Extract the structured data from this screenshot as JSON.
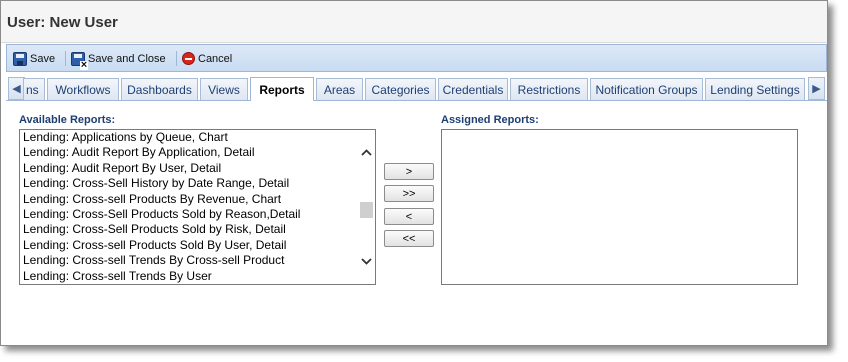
{
  "window": {
    "title": "User: New User"
  },
  "toolbar": {
    "save_label": "Save",
    "save_close_label": "Save and Close",
    "cancel_label": "Cancel"
  },
  "tabs": {
    "partial_label": "ns",
    "items": [
      {
        "label": "Workflows"
      },
      {
        "label": "Dashboards"
      },
      {
        "label": "Views"
      },
      {
        "label": "Reports",
        "active": true
      },
      {
        "label": "Areas"
      },
      {
        "label": "Categories"
      },
      {
        "label": "Credentials"
      },
      {
        "label": "Restrictions"
      },
      {
        "label": "Notification Groups"
      },
      {
        "label": "Lending Settings"
      }
    ]
  },
  "available": {
    "label": "Available Reports:",
    "items": [
      "Lending: Applications by Queue, Chart",
      "Lending: Audit Report By Application, Detail",
      "Lending: Audit Report By User, Detail",
      "Lending: Cross-Sell History by Date Range, Detail",
      "Lending: Cross-sell Products By Revenue, Chart",
      "Lending: Cross-Sell Products Sold by Reason,Detail",
      "Lending: Cross-Sell Products Sold by Risk, Detail",
      "Lending: Cross-sell Products Sold By User, Detail",
      "Lending: Cross-sell Trends By Cross-sell Product",
      "Lending: Cross-sell Trends By User"
    ]
  },
  "assigned": {
    "label": "Assigned Reports:",
    "items": []
  },
  "move_buttons": {
    "add_one": ">",
    "add_all": ">>",
    "remove_one": "<",
    "remove_all": "<<"
  },
  "colors": {
    "accent": "#1e3f73",
    "toolbar_bg": "#c9dcf2",
    "cancel_red": "#d9261c"
  }
}
